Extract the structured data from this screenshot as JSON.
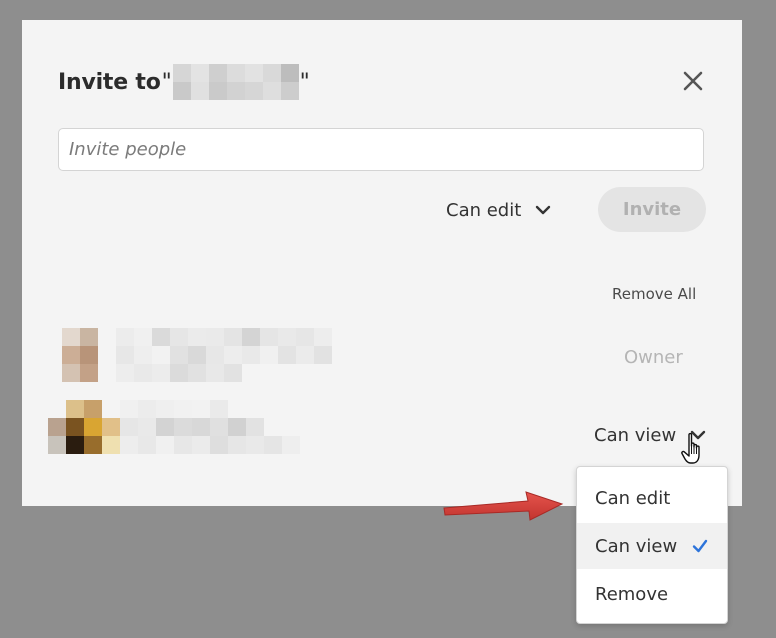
{
  "dialog": {
    "title_prefix": "Invite to ",
    "quote_open": "\"",
    "quote_close": "\"",
    "close_icon": "close-icon"
  },
  "invite": {
    "placeholder": "Invite people",
    "permission_selected": "Can edit",
    "button_label": "Invite"
  },
  "members": {
    "remove_all_label": "Remove All",
    "rows": [
      {
        "role": "Owner"
      },
      {
        "role": "Can view"
      }
    ]
  },
  "role_menu": {
    "items": [
      {
        "label": "Can edit",
        "selected": false
      },
      {
        "label": "Can view",
        "selected": true
      },
      {
        "label": "Remove",
        "selected": false
      }
    ],
    "check_icon": "checkmark-icon"
  },
  "annotation": {
    "arrow_color": "#d9403a"
  },
  "colors": {
    "overlay": "#8e8e8e",
    "dialog_bg": "#f4f4f4",
    "accent_check": "#2d74da"
  }
}
